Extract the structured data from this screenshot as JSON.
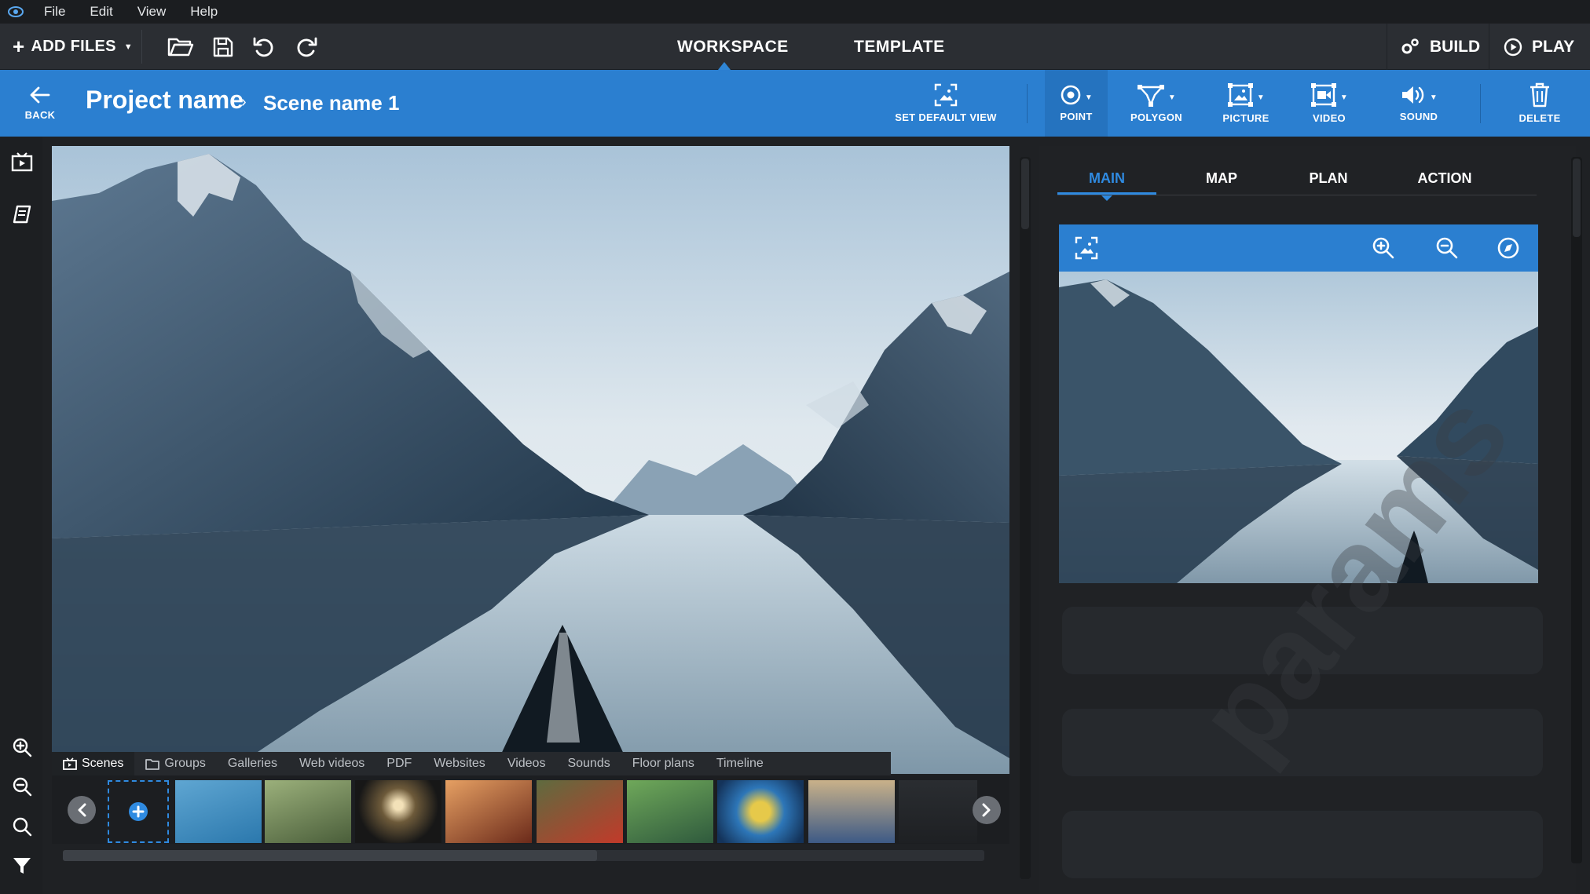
{
  "menu": {
    "items": [
      "File",
      "Edit",
      "View",
      "Help"
    ]
  },
  "toolbar": {
    "add_files": "ADD FILES",
    "modes": [
      "WORKSPACE",
      "TEMPLATE"
    ],
    "active_mode": "WORKSPACE",
    "build": "BUILD",
    "play": "PLAY",
    "icons": [
      "folder-open-icon",
      "save-icon",
      "undo-icon",
      "redo-icon"
    ]
  },
  "bluebar": {
    "back": "BACK",
    "project": "Project name",
    "separator": "›",
    "scene": "Scene name 1",
    "set_default_view": "SET DEFAULT VIEW",
    "tools": [
      {
        "label": "POINT",
        "icon": "target-point-icon",
        "active": true
      },
      {
        "label": "POLYGON",
        "icon": "polygon-icon",
        "active": false
      },
      {
        "label": "PICTURE",
        "icon": "picture-icon",
        "active": false
      },
      {
        "label": "VIDEO",
        "icon": "video-icon",
        "active": false
      },
      {
        "label": "SOUND",
        "icon": "sound-icon",
        "active": false
      }
    ],
    "delete": "DELETE"
  },
  "filmstrip": {
    "tabs": [
      {
        "label": "Scenes",
        "icon": "scenes-icon",
        "active": true
      },
      {
        "label": "Groups",
        "icon": "folder-icon",
        "active": false
      },
      {
        "label": "Galleries",
        "active": false
      },
      {
        "label": "Web videos",
        "active": false
      },
      {
        "label": "PDF",
        "active": false
      },
      {
        "label": "Websites",
        "active": false
      },
      {
        "label": "Videos",
        "active": false
      },
      {
        "label": "Sounds",
        "active": false
      },
      {
        "label": "Floor plans",
        "active": false
      },
      {
        "label": "Timeline",
        "active": false
      }
    ],
    "scroll_position": 0.58
  },
  "rightpanel": {
    "tabs": [
      "MAIN",
      "MAP",
      "PLAN",
      "ACTION"
    ],
    "active_tab": "MAIN"
  },
  "watermark": "params",
  "colors": {
    "accent": "#2b7fd0",
    "active_tab": "#2f8ae0",
    "background": "#1f2124"
  }
}
